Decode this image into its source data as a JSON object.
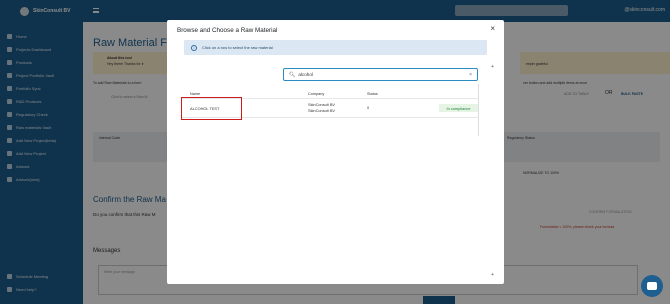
{
  "app": {
    "brand": "SkinConsult BV",
    "user": "@skinconsult.com"
  },
  "sidebar": {
    "items": [
      {
        "label": "Home",
        "icon": "home-icon"
      },
      {
        "label": "Projects Dashboard",
        "icon": "dashboard-icon"
      },
      {
        "label": "Products",
        "icon": "box-icon"
      },
      {
        "label": "Project Portfolio Vault",
        "icon": "vault-icon"
      },
      {
        "label": "Portfolio Sync",
        "icon": "sync-icon"
      },
      {
        "label": "R&D Products",
        "icon": "flask-icon"
      },
      {
        "label": "Regulatory Check",
        "icon": "check-icon"
      },
      {
        "label": "Raw materials Vault",
        "icon": "vault-icon"
      },
      {
        "label": "Add New Project(beta)",
        "icon": "plus-icon"
      },
      {
        "label": "Add New Project",
        "icon": "plus-icon"
      },
      {
        "label": "Artwork",
        "icon": "image-icon"
      },
      {
        "label": "Artwork(new)",
        "icon": "image-icon"
      }
    ],
    "bottom": [
      {
        "label": "Schedule Meeting",
        "icon": "calendar-icon"
      },
      {
        "label": "Need help?",
        "icon": "help-icon"
      }
    ]
  },
  "background": {
    "title": "Raw Material Fo",
    "alert_title": "About this tool",
    "alert_text": "Hey there! Thanks for tr",
    "alert_right": "eeper grateful",
    "add_hint": "To add Raw Materials to a form",
    "add_hint_right": "ver button and add multiple items at once",
    "select_placeholder": "Click to select a Raw M",
    "add_table": "ADD TO TABLE",
    "or": "OR",
    "bulk_paste": "BULK PASTE",
    "col_internal": "Internal Code",
    "col_regulatory": "Regulatory Status",
    "normalize": "NORMALIZE TO 100%",
    "confirm_title": "Confirm the Raw Ma",
    "confirm_text": "Do you confirm that this Raw M",
    "confirm_button": "CONFIRM FORMULATION",
    "warning": "Formulation < 100%, please check your formula",
    "messages": "Messages",
    "message_placeholder": "Write your message"
  },
  "modal": {
    "title": "Browse and Choose a Raw Material",
    "close": "×",
    "info": "Click on a row to select the raw material",
    "search_value": "alcohol",
    "columns": [
      "Name",
      "Company",
      "Status"
    ],
    "rows": [
      {
        "name": "ALCOHOL TEST",
        "company_1": "SkinConsult BV",
        "company_2": "SkinConsult BV",
        "status": "0",
        "compliance": "In compliance"
      }
    ]
  },
  "colors": {
    "primary": "#1e5f8f",
    "highlight": "#d11a1a",
    "compliance": "#1e7e34"
  }
}
